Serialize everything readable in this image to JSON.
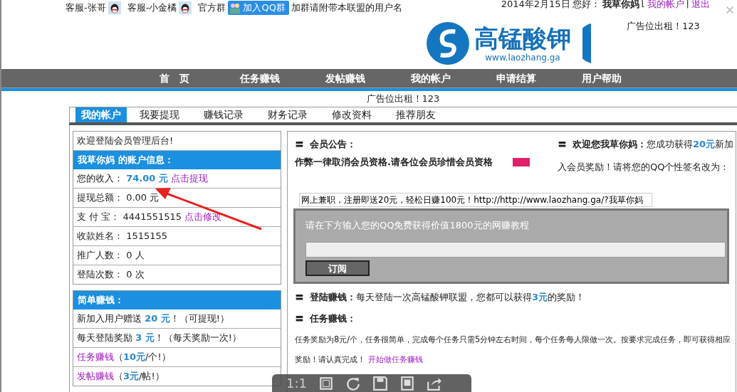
{
  "top_bar": {
    "contacts": [
      "客服-张哥",
      "客服-小金橘"
    ],
    "group_label": "官方群",
    "join_button": "加入QQ群",
    "group_note": "加群请附带本联盟的用户名",
    "date": "2014年2月15日",
    "greeting": "您好：",
    "username": "我草你妈",
    "bracket": "[",
    "links": [
      "我的帐户",
      "退出"
    ],
    "separator": "|"
  },
  "logo": {
    "name": "高锰酸钾",
    "url": "www.laozhang.ga"
  },
  "ad_right": "广告位出租！123",
  "nav": [
    "首　页",
    "任务赚钱",
    "发帖赚钱",
    "我的帐户",
    "申请结算",
    "用户帮助"
  ],
  "ad_center": "广告位出租！123",
  "tabs": [
    {
      "label": "我的帐户",
      "selected": true
    },
    {
      "label": "我要提现",
      "selected": false
    },
    {
      "label": "赚钱记录",
      "selected": false
    },
    {
      "label": "财务记录",
      "selected": false
    },
    {
      "label": "修改资料",
      "selected": false
    },
    {
      "label": "推荐朋友",
      "selected": false
    }
  ],
  "account": {
    "welcome": "欢迎登陆会员管理后台!",
    "header": "我草你妈 的账户信息：",
    "rows": [
      {
        "label": "您的收入：",
        "value": "74.00 元",
        "highlight": true,
        "link": "点击提现"
      },
      {
        "label": "提现总额：",
        "value": "0.00 元",
        "highlight": false
      },
      {
        "label": "支 付 宝：",
        "value": "4441551515",
        "highlight": false,
        "link": "点击修改"
      },
      {
        "label": "收款姓名：",
        "value": "1515155",
        "highlight": false
      },
      {
        "label": "推广人数：",
        "value": "0 人",
        "highlight": false
      },
      {
        "label": "登陆次数：",
        "value": "0 次",
        "highlight": false
      }
    ]
  },
  "easy_earn": {
    "header": "简单赚钱：",
    "items": [
      [
        {
          "kind": "plain",
          "text": "新加入用户赠送 "
        },
        {
          "kind": "amount",
          "text": "20 元"
        },
        {
          "kind": "plain",
          "text": "！（可提现!）"
        }
      ],
      [
        {
          "kind": "plain",
          "text": "每天登陆奖励 "
        },
        {
          "kind": "amount",
          "text": "3 元"
        },
        {
          "kind": "plain",
          "text": "！（每天奖励一次!）"
        }
      ],
      [
        {
          "kind": "link",
          "text": "任务赚钱"
        },
        {
          "kind": "plain",
          "text": "（"
        },
        {
          "kind": "amount",
          "text": "10元"
        },
        {
          "kind": "plain",
          "text": "/个!）"
        }
      ],
      [
        {
          "kind": "link",
          "text": "发帖赚钱"
        },
        {
          "kind": "plain",
          "text": "（"
        },
        {
          "kind": "amount",
          "text": "3元"
        },
        {
          "kind": "plain",
          "text": "/帖!）"
        }
      ]
    ]
  },
  "notice": {
    "bullet": "〓",
    "title": "会员公告：",
    "text": "作弊一律取消会员资格.请各位会员珍惜会员资格"
  },
  "welcome": {
    "title": "欢迎您我草你妈：",
    "segments": [
      {
        "kind": "plain",
        "text": "您成功获得"
      },
      {
        "kind": "amount",
        "text": "20元"
      },
      {
        "kind": "plain",
        "text": "新加入会员奖励！请将您的QQ个性签名改为："
      }
    ]
  },
  "signature_field": {
    "value": "网上兼职，注册即送20元，轻松日赚100元！http://http://www.laozhang.ga/?我草你妈"
  },
  "subscribe": {
    "prompt": "请在下方输入您的QQ免费获得价值1800元的网赚教程",
    "button": "订阅"
  },
  "sections": [
    {
      "title": "登陆赚钱：",
      "segments": [
        {
          "kind": "plain",
          "text": "每天登陆一次高锰酸钾联盟，您都可以获得"
        },
        {
          "kind": "amount",
          "text": "3元"
        },
        {
          "kind": "plain",
          "text": "的奖励！"
        }
      ]
    },
    {
      "title": "任务赚钱："
    },
    {
      "segments": [
        {
          "kind": "plain",
          "text": "任务奖励为8元/个，任务很简单，完成每个任务只需5分钟左右时间，每个任务每人限做一次。按要求完成任务，即可获得相应奖励！请认真完成！ "
        },
        {
          "kind": "link",
          "text": "开始做任务赚钱"
        }
      ]
    }
  ],
  "viewer_toolbar": {
    "zoom_label": "1:1"
  }
}
